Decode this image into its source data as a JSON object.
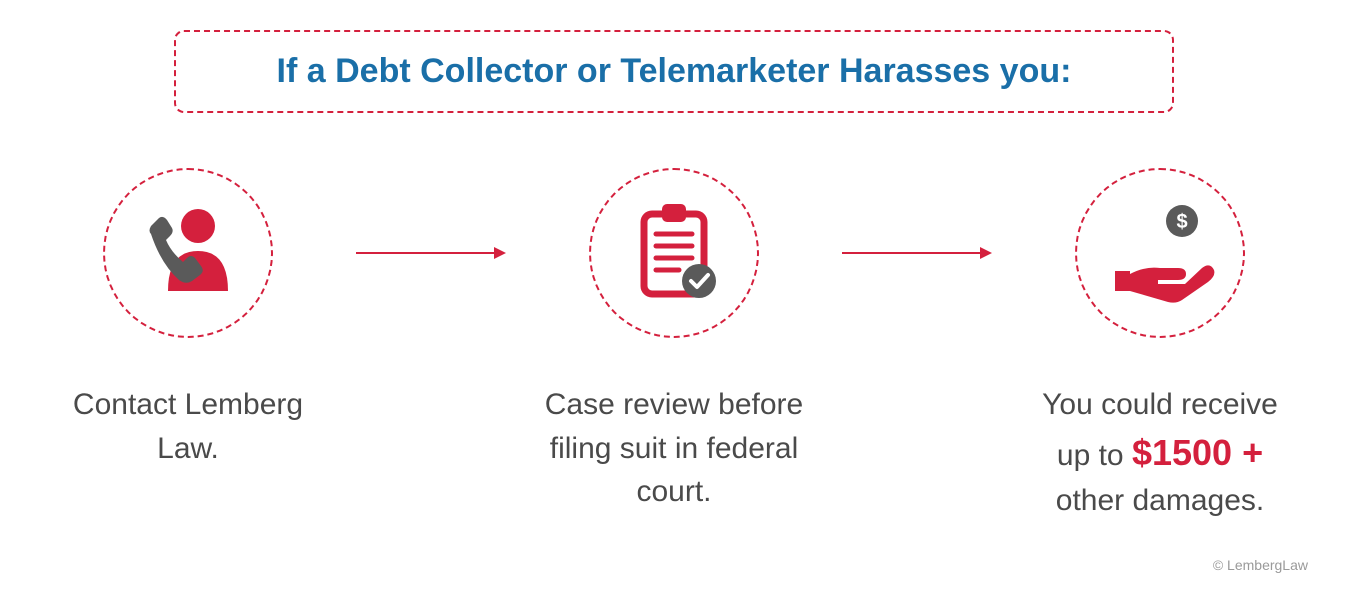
{
  "title": "If a Debt Collector or Telemarketer Harasses you:",
  "steps": {
    "step1": {
      "text": "Contact Lemberg Law.",
      "icon": "person-phone-icon"
    },
    "step2": {
      "text": "Case review before filing suit in federal court.",
      "icon": "clipboard-check-icon"
    },
    "step3": {
      "pre": "You could receive up to ",
      "highlight": "$1500 +",
      "post": " other damages.",
      "icon": "hand-money-icon"
    }
  },
  "copyright": "© LembergLaw",
  "colors": {
    "accent": "#d4203d",
    "title": "#1a6fa8",
    "bodyText": "#4a4a4a",
    "iconGray": "#5a5a5a"
  }
}
